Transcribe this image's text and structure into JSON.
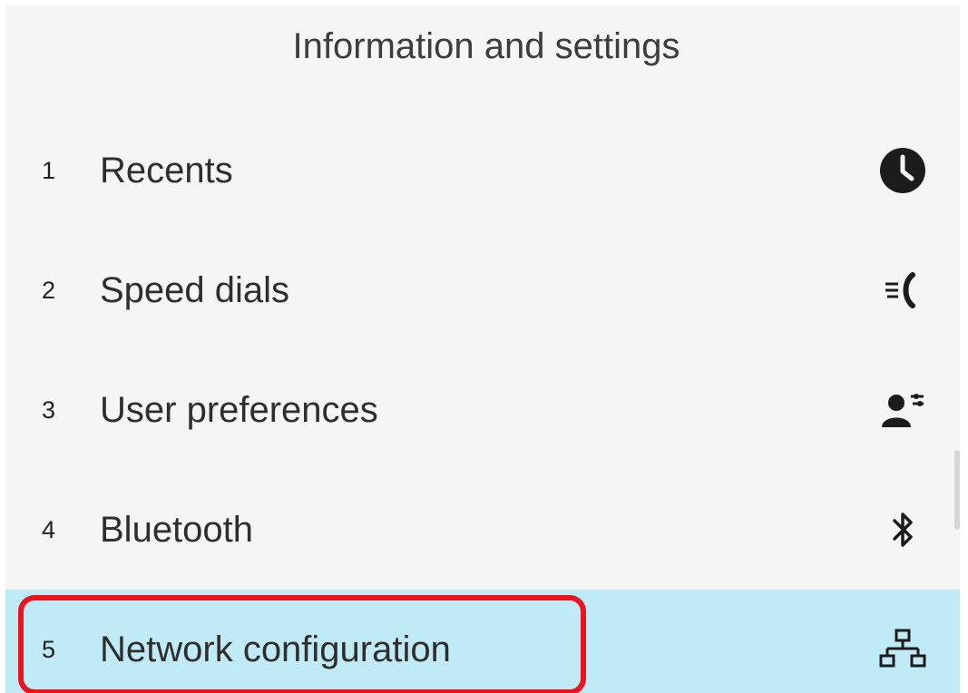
{
  "header": {
    "title": "Information and settings"
  },
  "menu": {
    "items": [
      {
        "number": "1",
        "label": "Recents",
        "icon": "clock-icon"
      },
      {
        "number": "2",
        "label": "Speed dials",
        "icon": "speed-dial-icon"
      },
      {
        "number": "3",
        "label": "User preferences",
        "icon": "user-preferences-icon"
      },
      {
        "number": "4",
        "label": "Bluetooth",
        "icon": "bluetooth-icon"
      },
      {
        "number": "5",
        "label": "Network configuration",
        "icon": "network-icon",
        "selected": true
      }
    ]
  },
  "colors": {
    "background": "#f5f5f5",
    "selected_row": "#bfeaf6",
    "highlight_border": "#e8141f",
    "text": "#2e2e2e"
  }
}
